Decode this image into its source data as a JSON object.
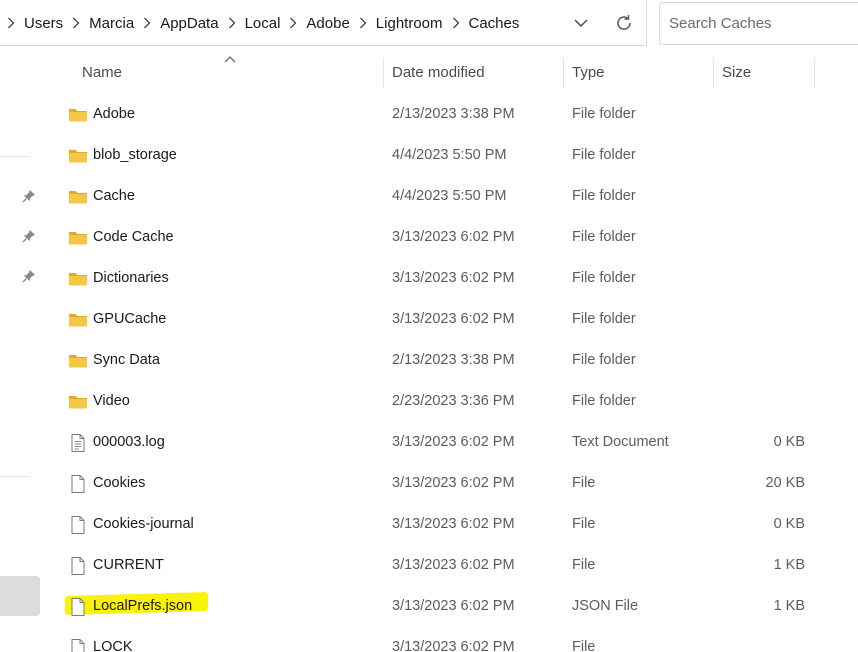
{
  "breadcrumb": [
    "Users",
    "Marcia",
    "AppData",
    "Local",
    "Adobe",
    "Lightroom",
    "Caches"
  ],
  "search": {
    "placeholder": "Search Caches"
  },
  "columns": {
    "name": "Name",
    "date": "Date modified",
    "type": "Type",
    "size": "Size"
  },
  "colors": {
    "folder": "#f6c744",
    "folder_dark": "#e3a92b",
    "highlight": "#fbf20a"
  },
  "files": [
    {
      "name": "Adobe",
      "date": "2/13/2023 3:38 PM",
      "type": "File folder",
      "size": "",
      "icon": "folder-icon"
    },
    {
      "name": "blob_storage",
      "date": "4/4/2023 5:50 PM",
      "type": "File folder",
      "size": "",
      "icon": "folder-icon"
    },
    {
      "name": "Cache",
      "date": "4/4/2023 5:50 PM",
      "type": "File folder",
      "size": "",
      "icon": "folder-icon"
    },
    {
      "name": "Code Cache",
      "date": "3/13/2023 6:02 PM",
      "type": "File folder",
      "size": "",
      "icon": "folder-icon"
    },
    {
      "name": "Dictionaries",
      "date": "3/13/2023 6:02 PM",
      "type": "File folder",
      "size": "",
      "icon": "folder-icon"
    },
    {
      "name": "GPUCache",
      "date": "3/13/2023 6:02 PM",
      "type": "File folder",
      "size": "",
      "icon": "folder-icon"
    },
    {
      "name": "Sync Data",
      "date": "2/13/2023 3:38 PM",
      "type": "File folder",
      "size": "",
      "icon": "folder-icon"
    },
    {
      "name": "Video",
      "date": "2/23/2023 3:36 PM",
      "type": "File folder",
      "size": "",
      "icon": "folder-icon"
    },
    {
      "name": "000003.log",
      "date": "3/13/2023 6:02 PM",
      "type": "Text Document",
      "size": "0 KB",
      "icon": "text-document-icon"
    },
    {
      "name": "Cookies",
      "date": "3/13/2023 6:02 PM",
      "type": "File",
      "size": "20 KB",
      "icon": "file-icon"
    },
    {
      "name": "Cookies-journal",
      "date": "3/13/2023 6:02 PM",
      "type": "File",
      "size": "0 KB",
      "icon": "file-icon"
    },
    {
      "name": "CURRENT",
      "date": "3/13/2023 6:02 PM",
      "type": "File",
      "size": "1 KB",
      "icon": "file-icon"
    },
    {
      "name": "LocalPrefs.json",
      "date": "3/13/2023 6:02 PM",
      "type": "JSON File",
      "size": "1 KB",
      "icon": "file-icon",
      "highlighted": true
    },
    {
      "name": "LOCK",
      "date": "3/13/2023 6:02 PM",
      "type": "File",
      "size": "",
      "icon": "file-icon"
    }
  ]
}
